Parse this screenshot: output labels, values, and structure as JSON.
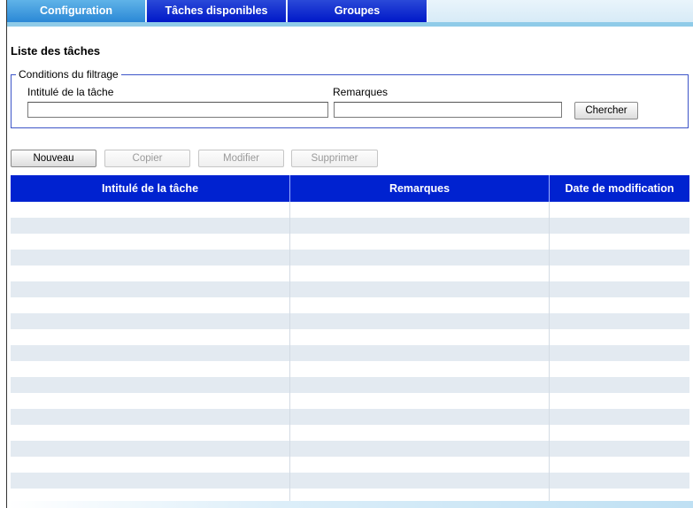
{
  "tabs": [
    {
      "label": "Configuration",
      "active": true
    },
    {
      "label": "Tâches disponibles",
      "active": false
    },
    {
      "label": "Groupes",
      "active": false
    }
  ],
  "page": {
    "title": "Liste des tâches"
  },
  "filter": {
    "legend": "Conditions du filtrage",
    "task_label": "Intitulé de la tâche",
    "task_value": "",
    "remarks_label": "Remarques",
    "remarks_value": "",
    "search_label": "Chercher"
  },
  "actions": {
    "new_label": "Nouveau",
    "copy_label": "Copier",
    "modify_label": "Modifier",
    "delete_label": "Supprimer"
  },
  "table": {
    "columns": [
      "Intitulé de la tâche",
      "Remarques",
      "Date de modification"
    ],
    "rows": []
  },
  "colors": {
    "tab_active": "#3a98dd",
    "tab_normal": "#0a24cc",
    "header_bg": "#0022d0",
    "row_alt": "#e3eaf1",
    "fieldset_border": "#3d55c8"
  }
}
